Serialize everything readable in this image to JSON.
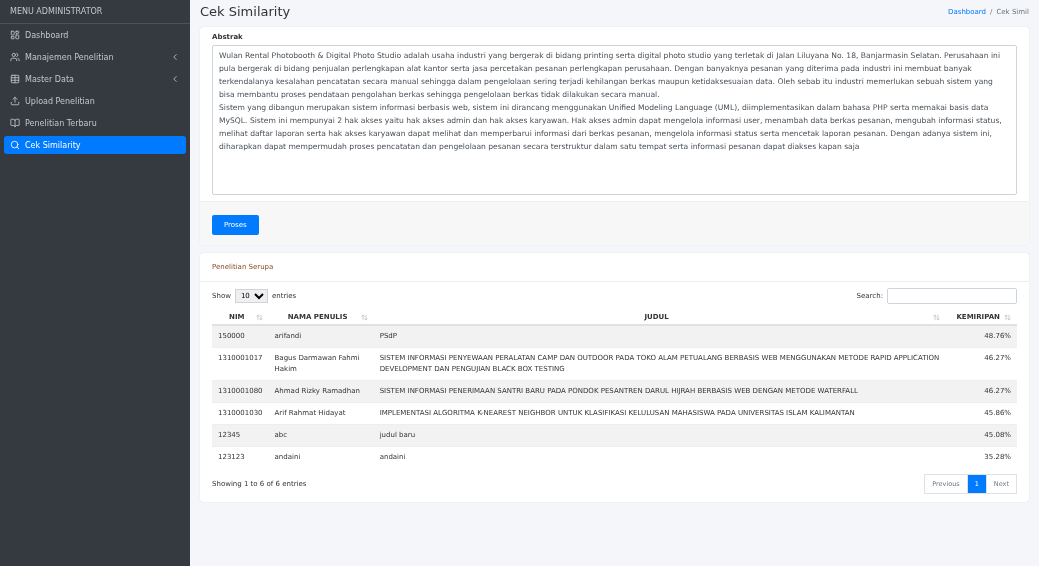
{
  "sidebar": {
    "brand": "MENU ADMINISTRATOR",
    "items": [
      {
        "label": "Dashboard",
        "expandable": false,
        "selected": false
      },
      {
        "label": "Manajemen Penelitian",
        "expandable": true,
        "selected": false
      },
      {
        "label": "Master Data",
        "expandable": true,
        "selected": false
      },
      {
        "label": "Upload Penelitian",
        "expandable": false,
        "selected": false
      },
      {
        "label": "Penelitian Terbaru",
        "expandable": false,
        "selected": false
      },
      {
        "label": "Cek Similarity",
        "expandable": false,
        "selected": true
      }
    ]
  },
  "header": {
    "title": "Cek Similarity",
    "breadcrumb": [
      "Dashboard",
      "Cek Simil"
    ],
    "separator": "/"
  },
  "abstract": {
    "label": "Abstrak",
    "value": "Wulan Rental Photobooth & Digital Photo Studio adalah usaha industri yang bergerak di bidang printing serta digital photo studio yang terletak di Jalan Liluyana No. 18, Banjarmasin Selatan. Perusahaan ini pula bergerak di bidang penjualan perlengkapan alat kantor serta jasa percetakan pesanan perlengkapan perusahaan. Dengan banyaknya pesanan yang diterima pada industri ini membuat banyak terkendalanya kesalahan pencatatan secara manual sehingga dalam pengelolaan sering terjadi kehilangan berkas maupun ketidaksesuaian data. Oleh sebab itu industri memerlukan sebuah sistem yang bisa membantu proses pendataan pengolahan berkas sehingga pengelolaan berkas tidak dilakukan secara manual.\nSistem yang dibangun merupakan sistem informasi berbasis web, sistem ini dirancang menggunakan Unified Modeling Language (UML), diimplementasikan dalam bahasa PHP serta memakai basis data MySQL. Sistem ini mempunyai 2 hak akses yaitu hak akses admin dan hak akses karyawan. Hak akses admin dapat mengelola informasi user, menambah data berkas pesanan, mengubah informasi status, melihat daftar laporan serta hak akses karyawan dapat melihat dan memperbarui informasi dari berkas pesanan, mengelola informasi status serta mencetak laporan pesanan. Dengan adanya sistem ini, diharapkan dapat mempermudah proses pencatatan dan pengelolaan pesanan secara terstruktur dalam satu tempat serta informasi pesanan dapat diakses kapan saja"
  },
  "process_button": "Proses",
  "results": {
    "title": "Penelitian Serupa",
    "show_label": "Show",
    "page_size": "10",
    "entries_label": "entries",
    "search_label": "Search:",
    "columns": [
      "NIM",
      "NAMA PENULIS",
      "JUDUL",
      "KEMIRIPAN"
    ],
    "rows": [
      [
        "150000",
        "arifandi",
        "PSdP",
        "48.76%"
      ],
      [
        "1310001017",
        "Bagus Darmawan Fahmi Hakim",
        "SISTEM INFORMASI PENYEWAAN PERALATAN CAMP DAN OUTDOOR PADA TOKO ALAM PETUALANG BERBASIS WEB MENGGUNAKAN METODE RAPID APPLICATION DEVELOPMENT DAN PENGUJIAN BLACK BOX TESTING",
        "46.27%"
      ],
      [
        "1310001080",
        "Ahmad Rizky Ramadhan",
        "SISTEM INFORMASI PENERIMAAN SANTRI BARU PADA PONDOK PESANTREN DARUL HIJRAH BERBASIS WEB DENGAN METODE WATERFALL",
        "46.27%"
      ],
      [
        "1310001030",
        "Arif Rahmat Hidayat",
        "IMPLEMENTASI ALGORITMA K-NEAREST NEIGHBOR UNTUK KLASIFIKASI KELULUSAN MAHASISWA PADA UNIVERSITAS ISLAM KALIMANTAN",
        "45.86%"
      ],
      [
        "12345",
        "abc",
        "judul baru",
        "45.08%"
      ],
      [
        "123123",
        "andaini",
        "andaini",
        "35.28%"
      ]
    ],
    "info": "Showing 1 to 6 of 6 entries",
    "pagination": [
      {
        "label": "Previous",
        "selected": false
      },
      {
        "label": "1",
        "selected": true
      },
      {
        "label": "Next",
        "selected": false
      }
    ]
  }
}
